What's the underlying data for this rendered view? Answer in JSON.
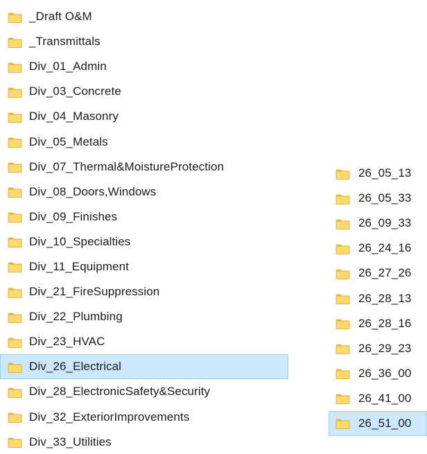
{
  "left_list": {
    "items": [
      {
        "label": "_Draft O&M",
        "selected": false
      },
      {
        "label": "_Transmittals",
        "selected": false
      },
      {
        "label": "Div_01_Admin",
        "selected": false
      },
      {
        "label": "Div_03_Concrete",
        "selected": false
      },
      {
        "label": "Div_04_Masonry",
        "selected": false
      },
      {
        "label": "Div_05_Metals",
        "selected": false
      },
      {
        "label": "Div_07_Thermal&MoistureProtection",
        "selected": false
      },
      {
        "label": "Div_08_Doors,Windows",
        "selected": false
      },
      {
        "label": "Div_09_Finishes",
        "selected": false
      },
      {
        "label": "Div_10_Specialties",
        "selected": false
      },
      {
        "label": "Div_11_Equipment",
        "selected": false
      },
      {
        "label": "Div_21_FireSuppression",
        "selected": false
      },
      {
        "label": "Div_22_Plumbing",
        "selected": false
      },
      {
        "label": "Div_23_HVAC",
        "selected": false
      },
      {
        "label": "Div_26_Electrical",
        "selected": true
      },
      {
        "label": "Div_28_ElectronicSafety&Security",
        "selected": false
      },
      {
        "label": "Div_32_ExteriorImprovements",
        "selected": false
      },
      {
        "label": "Div_33_Utilities",
        "selected": false
      }
    ]
  },
  "right_list": {
    "items": [
      {
        "label": "26_05_13",
        "selected": false
      },
      {
        "label": "26_05_33",
        "selected": false
      },
      {
        "label": "26_09_33",
        "selected": false
      },
      {
        "label": "26_24_16",
        "selected": false
      },
      {
        "label": "26_27_26",
        "selected": false
      },
      {
        "label": "26_28_13",
        "selected": false
      },
      {
        "label": "26_28_16",
        "selected": false
      },
      {
        "label": "26_29_23",
        "selected": false
      },
      {
        "label": "26_36_00",
        "selected": false
      },
      {
        "label": "26_41_00",
        "selected": false
      },
      {
        "label": "26_51_00",
        "selected": true
      }
    ]
  },
  "icon": "folder-icon",
  "colors": {
    "folder_body": "#ffd96b",
    "folder_back": "#e8b93c",
    "folder_edge": "#d9a62c",
    "selection_fill": "#cce8ff",
    "selection_border": "#99d1ff",
    "text": "#1a1a1a"
  }
}
